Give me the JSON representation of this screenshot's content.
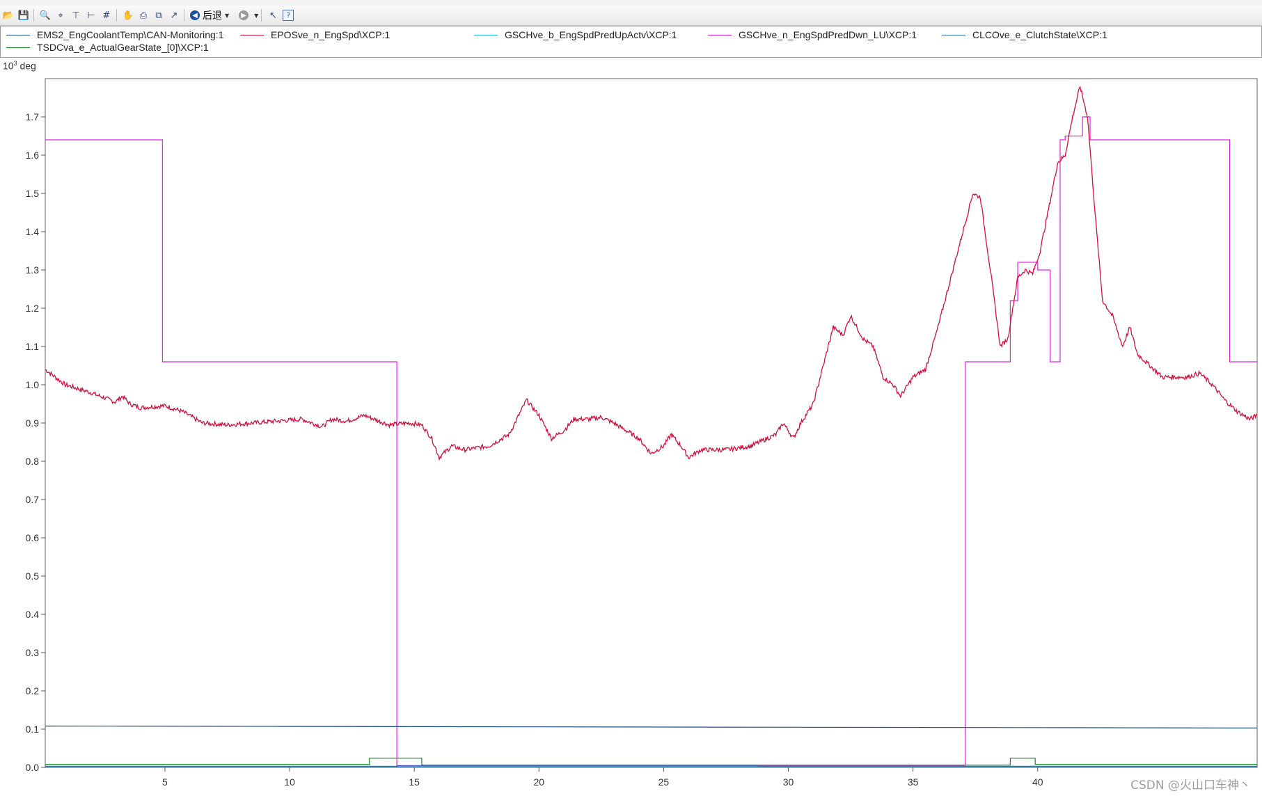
{
  "toolbar": {
    "back_label": "后退"
  },
  "legend": [
    {
      "label": "EMS2_EngCoolantTemp\\CAN-Monitoring:1",
      "color": "#1f4e8c"
    },
    {
      "label": "EPOSve_n_EngSpd\\XCP:1",
      "color": "#d0103a"
    },
    {
      "label": "GSCHve_b_EngSpdPredUpActv\\XCP:1",
      "color": "#22b8e6"
    },
    {
      "label": "GSCHve_n_EngSpdPredDwn_LU\\XCP:1",
      "color": "#e020e0"
    },
    {
      "label": "CLCOve_e_ClutchState\\XCP:1",
      "color": "#2e6fc4"
    },
    {
      "label": "TSDCva_e_ActualGearState_[0]\\XCP:1",
      "color": "#1a8a2a"
    }
  ],
  "y_unit": {
    "base": "10",
    "exp": "3",
    "unit": "deg"
  },
  "watermark": "CSDN @火山口车神丶",
  "chart_data": {
    "type": "line",
    "xlim": [
      0.2,
      48.8
    ],
    "ylim": [
      0.0,
      1.8
    ],
    "x_ticks": [
      5,
      10,
      15,
      20,
      25,
      30,
      35,
      40
    ],
    "x_tick_labels": [
      "5",
      "10",
      "15",
      "20",
      "25",
      "30",
      "35",
      "40"
    ],
    "y_ticks": [
      0.0,
      0.1,
      0.2,
      0.3,
      0.4,
      0.5,
      0.6,
      0.7,
      0.8,
      0.9,
      1.0,
      1.1,
      1.2,
      1.3,
      1.4,
      1.5,
      1.6,
      1.7
    ],
    "y_tick_labels": [
      "0.0",
      "0.1",
      "0.2",
      "0.3",
      "0.4",
      "0.5",
      "0.6",
      "0.7",
      "0.8",
      "0.9",
      "1.0",
      "1.1",
      "1.2",
      "1.3",
      "1.4",
      "1.5",
      "1.6",
      "1.7"
    ],
    "series": [
      {
        "name": "GSCHve_n_EngSpdPredDwn_LU\\XCP:1",
        "color": "#e020e0",
        "step": true,
        "points": [
          [
            0.2,
            1.64
          ],
          [
            4.9,
            1.64
          ],
          [
            4.9,
            1.06
          ],
          [
            14.3,
            1.06
          ],
          [
            14.3,
            0.005
          ],
          [
            37.1,
            0.005
          ],
          [
            37.1,
            1.06
          ],
          [
            38.9,
            1.06
          ],
          [
            38.9,
            1.22
          ],
          [
            39.2,
            1.22
          ],
          [
            39.2,
            1.32
          ],
          [
            40.0,
            1.32
          ],
          [
            40.0,
            1.3
          ],
          [
            40.5,
            1.3
          ],
          [
            40.5,
            1.06
          ],
          [
            40.9,
            1.06
          ],
          [
            40.9,
            1.64
          ],
          [
            41.1,
            1.64
          ],
          [
            41.1,
            1.65
          ],
          [
            41.8,
            1.65
          ],
          [
            41.8,
            1.7
          ],
          [
            42.1,
            1.7
          ],
          [
            42.1,
            1.64
          ],
          [
            47.7,
            1.64
          ],
          [
            47.7,
            1.06
          ],
          [
            48.8,
            1.06
          ]
        ]
      },
      {
        "name": "EPOSve_n_EngSpd\\XCP:1",
        "color": "#d0103a",
        "step": false,
        "points": [
          [
            0.2,
            1.04
          ],
          [
            1.0,
            1.0
          ],
          [
            2.0,
            0.98
          ],
          [
            3.0,
            0.955
          ],
          [
            3.3,
            0.97
          ],
          [
            3.6,
            0.95
          ],
          [
            4.0,
            0.94
          ],
          [
            5.0,
            0.945
          ],
          [
            5.7,
            0.93
          ],
          [
            6.5,
            0.9
          ],
          [
            7.5,
            0.895
          ],
          [
            8.5,
            0.9
          ],
          [
            9.5,
            0.905
          ],
          [
            10.5,
            0.91
          ],
          [
            11.3,
            0.89
          ],
          [
            11.7,
            0.91
          ],
          [
            12.3,
            0.905
          ],
          [
            13.0,
            0.92
          ],
          [
            14.0,
            0.895
          ],
          [
            14.8,
            0.9
          ],
          [
            15.3,
            0.895
          ],
          [
            15.7,
            0.86
          ],
          [
            16.0,
            0.81
          ],
          [
            16.5,
            0.84
          ],
          [
            17.0,
            0.83
          ],
          [
            18.0,
            0.84
          ],
          [
            18.8,
            0.87
          ],
          [
            19.5,
            0.96
          ],
          [
            20.0,
            0.92
          ],
          [
            20.5,
            0.86
          ],
          [
            21.0,
            0.88
          ],
          [
            21.4,
            0.91
          ],
          [
            22.0,
            0.91
          ],
          [
            22.5,
            0.915
          ],
          [
            23.0,
            0.9
          ],
          [
            24.0,
            0.86
          ],
          [
            24.5,
            0.82
          ],
          [
            25.0,
            0.84
          ],
          [
            25.3,
            0.87
          ],
          [
            25.7,
            0.84
          ],
          [
            26.0,
            0.81
          ],
          [
            26.5,
            0.83
          ],
          [
            27.5,
            0.83
          ],
          [
            28.5,
            0.84
          ],
          [
            29.5,
            0.87
          ],
          [
            29.8,
            0.9
          ],
          [
            30.2,
            0.86
          ],
          [
            30.5,
            0.9
          ],
          [
            31.0,
            0.95
          ],
          [
            31.4,
            1.05
          ],
          [
            31.8,
            1.15
          ],
          [
            32.2,
            1.13
          ],
          [
            32.5,
            1.18
          ],
          [
            33.0,
            1.12
          ],
          [
            33.4,
            1.1
          ],
          [
            33.8,
            1.02
          ],
          [
            34.2,
            1.0
          ],
          [
            34.5,
            0.97
          ],
          [
            35.0,
            1.02
          ],
          [
            35.5,
            1.04
          ],
          [
            36.0,
            1.15
          ],
          [
            36.6,
            1.3
          ],
          [
            37.0,
            1.4
          ],
          [
            37.4,
            1.5
          ],
          [
            37.7,
            1.49
          ],
          [
            38.1,
            1.3
          ],
          [
            38.5,
            1.1
          ],
          [
            38.8,
            1.12
          ],
          [
            39.2,
            1.28
          ],
          [
            39.5,
            1.3
          ],
          [
            39.8,
            1.29
          ],
          [
            40.1,
            1.35
          ],
          [
            40.5,
            1.48
          ],
          [
            40.8,
            1.58
          ],
          [
            41.1,
            1.6
          ],
          [
            41.4,
            1.7
          ],
          [
            41.7,
            1.78
          ],
          [
            42.0,
            1.7
          ],
          [
            42.3,
            1.45
          ],
          [
            42.6,
            1.22
          ],
          [
            43.0,
            1.18
          ],
          [
            43.4,
            1.1
          ],
          [
            43.7,
            1.15
          ],
          [
            44.0,
            1.08
          ],
          [
            44.5,
            1.05
          ],
          [
            45.0,
            1.02
          ],
          [
            45.5,
            1.02
          ],
          [
            46.0,
            1.02
          ],
          [
            46.5,
            1.03
          ],
          [
            47.0,
            1.0
          ],
          [
            47.5,
            0.96
          ],
          [
            48.0,
            0.93
          ],
          [
            48.5,
            0.91
          ],
          [
            48.8,
            0.92
          ]
        ]
      },
      {
        "name": "EMS2_EngCoolantTemp\\CAN-Monitoring:1",
        "color": "#1f4e8c",
        "step": false,
        "points": [
          [
            0.2,
            0.108
          ],
          [
            10.0,
            0.107
          ],
          [
            20.0,
            0.106
          ],
          [
            30.0,
            0.105
          ],
          [
            40.0,
            0.104
          ],
          [
            48.8,
            0.103
          ]
        ]
      },
      {
        "name": "TSDCva_e_ActualGearState_[0]\\XCP:1",
        "color": "#1a8a2a",
        "step": true,
        "points": [
          [
            0.2,
            0.008
          ],
          [
            13.2,
            0.008
          ],
          [
            13.2,
            0.024
          ],
          [
            15.3,
            0.024
          ],
          [
            15.3,
            0.006
          ],
          [
            38.9,
            0.006
          ],
          [
            38.9,
            0.024
          ],
          [
            39.9,
            0.024
          ],
          [
            39.9,
            0.008
          ],
          [
            48.8,
            0.008
          ]
        ]
      },
      {
        "name": "GSCHve_b_EngSpdPredUpActv\\XCP:1",
        "color": "#22b8e6",
        "step": false,
        "points": [
          [
            0.2,
            0.002
          ],
          [
            48.8,
            0.002
          ]
        ]
      },
      {
        "name": "CLCOve_e_ClutchState\\XCP:1",
        "color": "#2e6fc4",
        "step": true,
        "points": [
          [
            0.2,
            0.003
          ],
          [
            14.3,
            0.003
          ],
          [
            14.3,
            0.004
          ],
          [
            28.8,
            0.004
          ],
          [
            28.8,
            0.003
          ],
          [
            48.8,
            0.003
          ]
        ]
      }
    ]
  }
}
